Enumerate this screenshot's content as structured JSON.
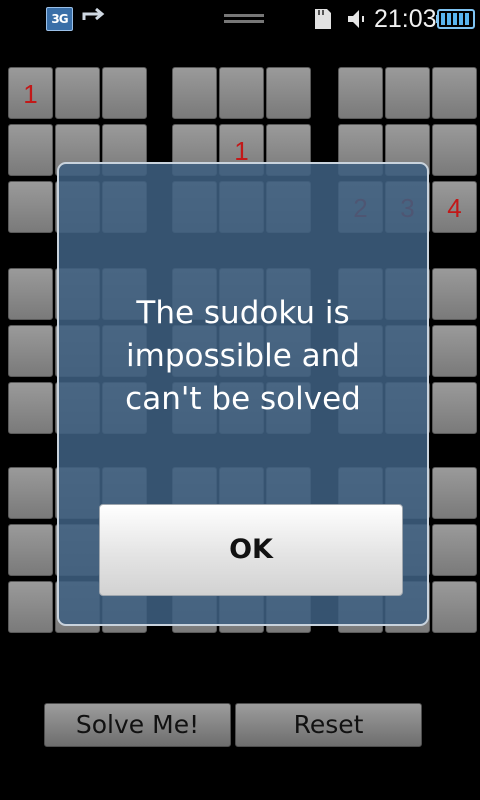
{
  "status_bar": {
    "network": "3G",
    "time": "21:03",
    "icons": [
      "3g-icon",
      "sync-icon",
      "handle-icon",
      "sd-card-icon",
      "volume-icon",
      "battery-icon"
    ]
  },
  "grid": {
    "digit_color": "#c21818",
    "visible_digits": [
      {
        "row": 1,
        "col": 1,
        "value": "1"
      },
      {
        "row": 2,
        "col": 5,
        "value": "1"
      },
      {
        "row": 3,
        "col": 7,
        "value": "2"
      },
      {
        "row": 3,
        "col": 8,
        "value": "3"
      },
      {
        "row": 3,
        "col": 9,
        "value": "4"
      }
    ]
  },
  "dialog": {
    "message": "The sudoku is\nimpossible and\ncan't be solved",
    "ok_label": "OK"
  },
  "actions": {
    "solve_label": "Solve Me!",
    "reset_label": "Reset"
  }
}
